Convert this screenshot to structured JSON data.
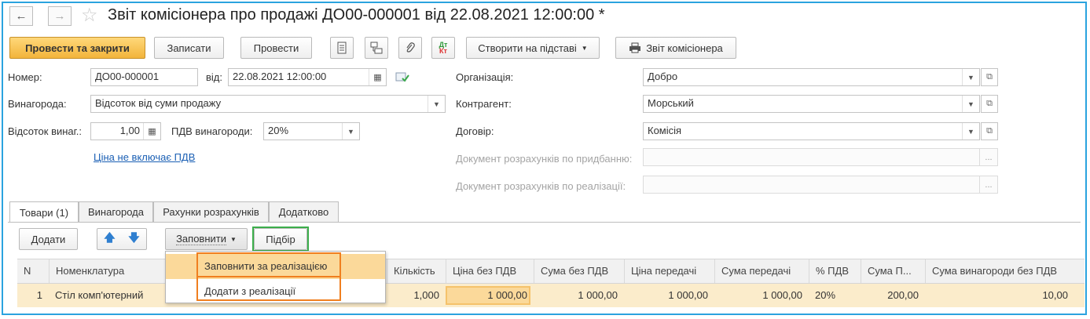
{
  "window": {
    "title": "Звіт комісіонера про продажі ДО00-000001 від 22.08.2021 12:00:00 *"
  },
  "toolbar": {
    "post_close": "Провести та закрити",
    "save": "Записати",
    "post": "Провести",
    "create_based": "Створити на підставі",
    "report": "Звіт комісіонера",
    "dtkt_icon_text_top": "Дт",
    "dtkt_icon_text_bottom": "Кт"
  },
  "form": {
    "number_label": "Номер:",
    "number_value": "ДО00-000001",
    "date_label": "від:",
    "date_value": "22.08.2021 12:00:00",
    "reward_label": "Винагорода:",
    "reward_value": "Відсоток від суми продажу",
    "reward_pct_label": "Відсоток винаг.:",
    "reward_pct_value": "1,00",
    "vat_reward_label": "ПДВ винагороди:",
    "vat_reward_value": "20%",
    "price_link": "Ціна не включає ПДВ",
    "org_label": "Організація:",
    "org_value": "Добро",
    "contractor_label": "Контрагент:",
    "contractor_value": "Морський",
    "contract_label": "Договір:",
    "contract_value": "Комісія",
    "purchase_doc_label": "Документ розрахунків по придбанню:",
    "sale_doc_label": "Документ розрахунків по реалізації:",
    "more_dots": "..."
  },
  "tabs": [
    {
      "label": "Товари (1)"
    },
    {
      "label": "Винагорода"
    },
    {
      "label": "Рахунки розрахунків"
    },
    {
      "label": "Додатково"
    }
  ],
  "table_toolbar": {
    "add": "Додати",
    "fill": "Заповнити",
    "pick": "Підбір"
  },
  "fill_menu": {
    "items": [
      {
        "label": "Заповнити за реалізацією"
      },
      {
        "label": "Додати з реалізації"
      }
    ]
  },
  "table": {
    "columns": [
      "N",
      "Номенклатура",
      "Кількість",
      "Ціна без ПДВ",
      "Сума без ПДВ",
      "Ціна передачі",
      "Сума передачі",
      "% ПДВ",
      "Сума П...",
      "Сума винагороди без ПДВ"
    ],
    "rows": [
      {
        "n": "1",
        "name": "Стіл комп'ютерний",
        "qty": "1,000",
        "price": "1 000,00",
        "sum": "1 000,00",
        "tprice": "1 000,00",
        "tsum": "1 000,00",
        "vat": "20%",
        "vat_sum": "200,00",
        "reward": "10,00"
      }
    ]
  },
  "colors": {
    "frame": "#2aa3df",
    "primary_button": "#f2b43b",
    "highlight": "#fbd99a",
    "orange_outline": "#f07f1f",
    "green_outline": "#3cae4b",
    "link": "#1a5fb4"
  }
}
